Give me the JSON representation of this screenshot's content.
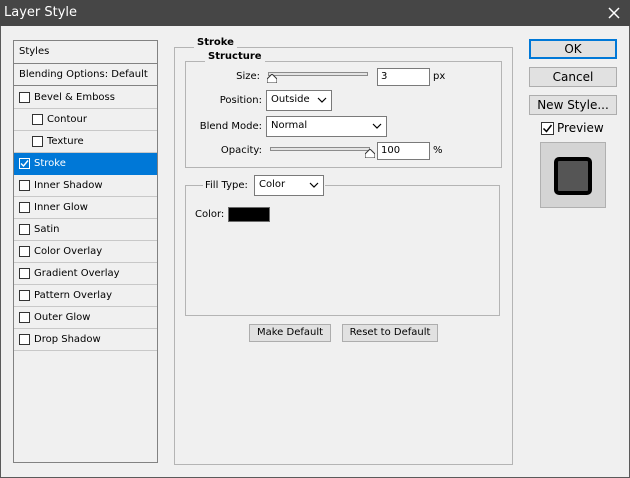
{
  "window": {
    "title": "Layer Style",
    "close_icon": "close-icon"
  },
  "left_panel": {
    "header": "Styles",
    "blending_options": "Blending Options: Default",
    "items": [
      {
        "label": "Bevel & Emboss",
        "checked": false,
        "indent": false
      },
      {
        "label": "Contour",
        "checked": false,
        "indent": true
      },
      {
        "label": "Texture",
        "checked": false,
        "indent": true
      },
      {
        "label": "Stroke",
        "checked": true,
        "indent": false,
        "selected": true
      },
      {
        "label": "Inner Shadow",
        "checked": false,
        "indent": false
      },
      {
        "label": "Inner Glow",
        "checked": false,
        "indent": false
      },
      {
        "label": "Satin",
        "checked": false,
        "indent": false
      },
      {
        "label": "Color Overlay",
        "checked": false,
        "indent": false
      },
      {
        "label": "Gradient Overlay",
        "checked": false,
        "indent": false
      },
      {
        "label": "Pattern Overlay",
        "checked": false,
        "indent": false
      },
      {
        "label": "Outer Glow",
        "checked": false,
        "indent": false
      },
      {
        "label": "Drop Shadow",
        "checked": false,
        "indent": false
      }
    ]
  },
  "stroke": {
    "title": "Stroke",
    "structure": {
      "title": "Structure",
      "size_label": "Size:",
      "size_value": "3",
      "size_unit": "px",
      "size_slider_fraction": 0.0,
      "position_label": "Position:",
      "position_value": "Outside",
      "blend_label": "Blend Mode:",
      "blend_value": "Normal",
      "opacity_label": "Opacity:",
      "opacity_value": "100",
      "opacity_unit": "%",
      "opacity_slider_fraction": 1.0
    },
    "fill": {
      "type_label": "Fill Type:",
      "type_value": "Color",
      "color_label": "Color:",
      "color_value": "#000000"
    },
    "make_default": "Make Default",
    "reset_default": "Reset to Default"
  },
  "actions": {
    "ok": "OK",
    "cancel": "Cancel",
    "new_style": "New Style...",
    "preview_label": "Preview",
    "preview_checked": true
  }
}
